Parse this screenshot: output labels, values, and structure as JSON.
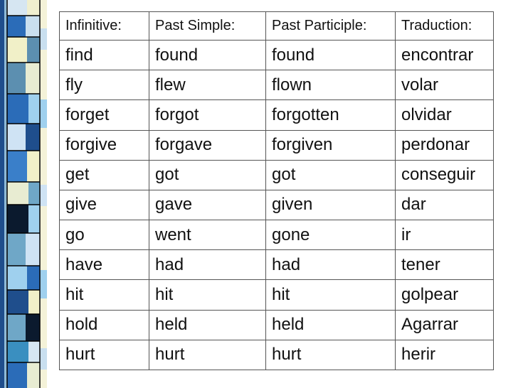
{
  "table": {
    "headers": [
      "Infinitive:",
      "Past Simple:",
      "Past Participle:",
      "Traduction:"
    ],
    "rows": [
      [
        "find",
        "found",
        "found",
        "encontrar"
      ],
      [
        "fly",
        "flew",
        "flown",
        "volar"
      ],
      [
        "forget",
        "forgot",
        "forgotten",
        "olvidar"
      ],
      [
        "forgive",
        "forgave",
        "forgiven",
        "perdonar"
      ],
      [
        "get",
        "got",
        "got",
        "conseguir"
      ],
      [
        "give",
        "gave",
        "given",
        "dar"
      ],
      [
        "go",
        "went",
        "gone",
        "ir"
      ],
      [
        "have",
        "had",
        "had",
        "tener"
      ],
      [
        "hit",
        "hit",
        "hit",
        "golpear"
      ],
      [
        "hold",
        "held",
        "held",
        "Agarrar"
      ],
      [
        "hurt",
        "hurt",
        "hurt",
        "herir"
      ]
    ]
  },
  "colors": {
    "border": "#222222",
    "text": "#111111",
    "strip_palette": [
      "#1f4e8c",
      "#f1f0c8",
      "#5c8fb0",
      "#cfe3f4",
      "#2b6cb8",
      "#0b1a2e",
      "#6fa7c7",
      "#9fd0ee",
      "#e8ecd2"
    ]
  }
}
